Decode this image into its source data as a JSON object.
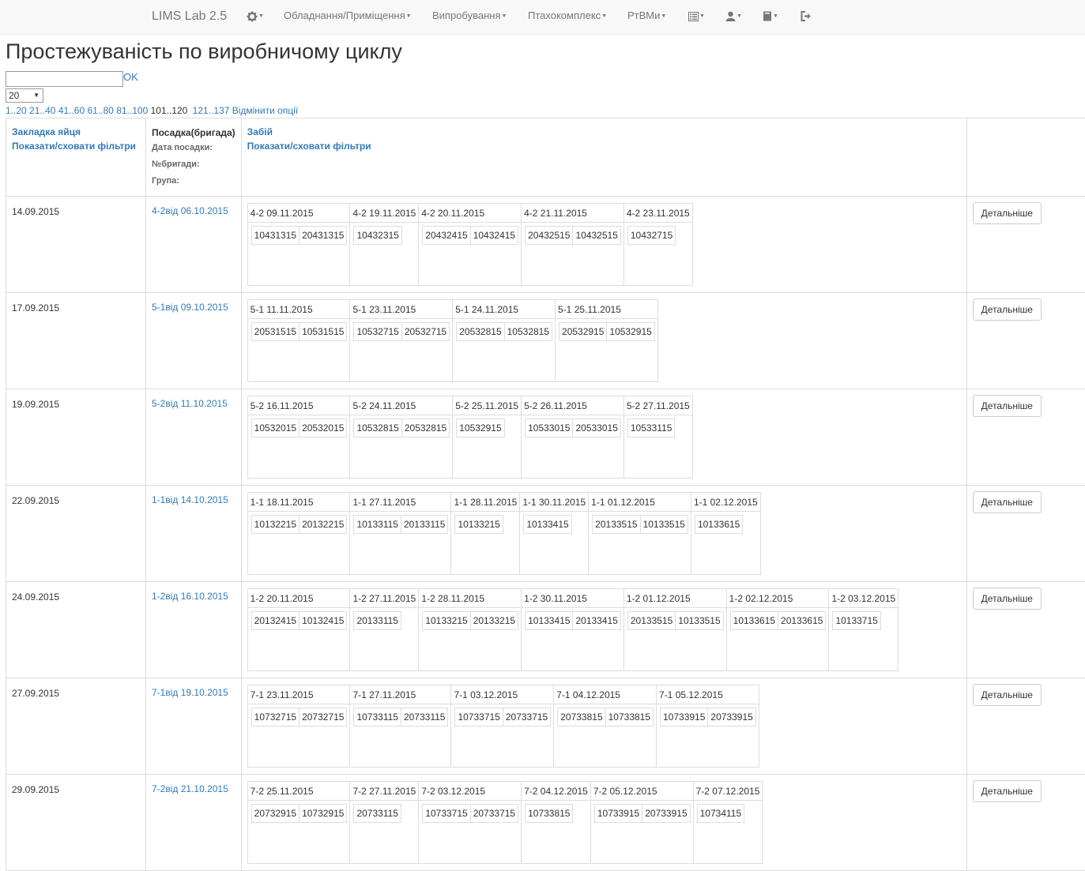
{
  "navbar": {
    "brand": "LIMS Lab 2.5",
    "menu": [
      {
        "label": "Обладнання/Приміщення"
      },
      {
        "label": "Випробування"
      },
      {
        "label": "Птахокомплекс"
      },
      {
        "label": "РтВМи"
      }
    ]
  },
  "page": {
    "title": "Простежуваність по виробничому циклу",
    "search_value": "",
    "ok_label": "OK",
    "page_size": "20",
    "pager": [
      {
        "label": "1..20",
        "current": false
      },
      {
        "label": "21..40",
        "current": false
      },
      {
        "label": "41..60",
        "current": false
      },
      {
        "label": "61..80",
        "current": false
      },
      {
        "label": "81..100",
        "current": false
      },
      {
        "label": "101..120",
        "current": true
      },
      {
        "label": "121..137",
        "current": false
      },
      {
        "label": "Відмінити опції",
        "current": false
      }
    ]
  },
  "table": {
    "col1_title": "Закладка яйця",
    "col1_filter": "Показати/сховати фільтри",
    "col2_title": "Посадка(бригада)",
    "col2_sub1": "Дата посадки:",
    "col2_sub2": "№бригади:",
    "col2_sub3": "Група:",
    "col3_title": "Забій",
    "col3_filter": "Показати/сховати фільтри",
    "details_label": "Детальніше",
    "rows": [
      {
        "date": "14.09.2015",
        "pos": "4-2від 06.10.2015",
        "slaughters": [
          {
            "head": "4-2 09.11.2015",
            "codes": [
              "10431315",
              "20431315"
            ]
          },
          {
            "head": "4-2 19.11.2015",
            "codes": [
              "10432315"
            ]
          },
          {
            "head": "4-2 20.11.2015",
            "codes": [
              "20432415",
              "10432415"
            ]
          },
          {
            "head": "4-2 21.11.2015",
            "codes": [
              "20432515",
              "10432515"
            ]
          },
          {
            "head": "4-2 23.11.2015",
            "codes": [
              "10432715"
            ]
          }
        ]
      },
      {
        "date": "17.09.2015",
        "pos": "5-1від 09.10.2015",
        "slaughters": [
          {
            "head": "5-1 11.11.2015",
            "codes": [
              "20531515",
              "10531515"
            ]
          },
          {
            "head": "5-1 23.11.2015",
            "codes": [
              "10532715",
              "20532715"
            ]
          },
          {
            "head": "5-1 24.11.2015",
            "codes": [
              "20532815",
              "10532815"
            ]
          },
          {
            "head": "5-1 25.11.2015",
            "codes": [
              "20532915",
              "10532915"
            ]
          }
        ]
      },
      {
        "date": "19.09.2015",
        "pos": "5-2від 11.10.2015",
        "slaughters": [
          {
            "head": "5-2 16.11.2015",
            "codes": [
              "10532015",
              "20532015"
            ]
          },
          {
            "head": "5-2 24.11.2015",
            "codes": [
              "10532815",
              "20532815"
            ]
          },
          {
            "head": "5-2 25.11.2015",
            "codes": [
              "10532915"
            ]
          },
          {
            "head": "5-2 26.11.2015",
            "codes": [
              "10533015",
              "20533015"
            ]
          },
          {
            "head": "5-2 27.11.2015",
            "codes": [
              "10533115"
            ]
          }
        ]
      },
      {
        "date": "22.09.2015",
        "pos": "1-1від 14.10.2015",
        "slaughters": [
          {
            "head": "1-1 18.11.2015",
            "codes": [
              "10132215",
              "20132215"
            ]
          },
          {
            "head": "1-1 27.11.2015",
            "codes": [
              "10133115",
              "20133115"
            ]
          },
          {
            "head": "1-1 28.11.2015",
            "codes": [
              "10133215"
            ]
          },
          {
            "head": "1-1 30.11.2015",
            "codes": [
              "10133415"
            ]
          },
          {
            "head": "1-1 01.12.2015",
            "codes": [
              "20133515",
              "10133515"
            ]
          },
          {
            "head": "1-1 02.12.2015",
            "codes": [
              "10133615"
            ]
          }
        ]
      },
      {
        "date": "24.09.2015",
        "pos": "1-2від 16.10.2015",
        "slaughters": [
          {
            "head": "1-2 20.11.2015",
            "codes": [
              "20132415",
              "10132415"
            ]
          },
          {
            "head": "1-2 27.11.2015",
            "codes": [
              "20133115"
            ]
          },
          {
            "head": "1-2 28.11.2015",
            "codes": [
              "10133215",
              "20133215"
            ]
          },
          {
            "head": "1-2 30.11.2015",
            "codes": [
              "10133415",
              "20133415"
            ]
          },
          {
            "head": "1-2 01.12.2015",
            "codes": [
              "20133515",
              "10133515"
            ]
          },
          {
            "head": "1-2 02.12.2015",
            "codes": [
              "10133615",
              "20133615"
            ]
          },
          {
            "head": "1-2 03.12.2015",
            "codes": [
              "10133715"
            ]
          }
        ]
      },
      {
        "date": "27.09.2015",
        "pos": "7-1від 19.10.2015",
        "slaughters": [
          {
            "head": "7-1 23.11.2015",
            "codes": [
              "10732715",
              "20732715"
            ]
          },
          {
            "head": "7-1 27.11.2015",
            "codes": [
              "10733115",
              "20733115"
            ]
          },
          {
            "head": "7-1 03.12.2015",
            "codes": [
              "10733715",
              "20733715"
            ]
          },
          {
            "head": "7-1 04.12.2015",
            "codes": [
              "20733815",
              "10733815"
            ]
          },
          {
            "head": "7-1 05.12.2015",
            "codes": [
              "10733915",
              "20733915"
            ]
          }
        ]
      },
      {
        "date": "29.09.2015",
        "pos": "7-2від 21.10.2015",
        "slaughters": [
          {
            "head": "7-2 25.11.2015",
            "codes": [
              "20732915",
              "10732915"
            ]
          },
          {
            "head": "7-2 27.11.2015",
            "codes": [
              "20733115"
            ]
          },
          {
            "head": "7-2 03.12.2015",
            "codes": [
              "10733715",
              "20733715"
            ]
          },
          {
            "head": "7-2 04.12.2015",
            "codes": [
              "10733815"
            ]
          },
          {
            "head": "7-2 05.12.2015",
            "codes": [
              "10733915",
              "20733915"
            ]
          },
          {
            "head": "7-2 07.12.2015",
            "codes": [
              "10734115"
            ]
          }
        ]
      }
    ]
  }
}
